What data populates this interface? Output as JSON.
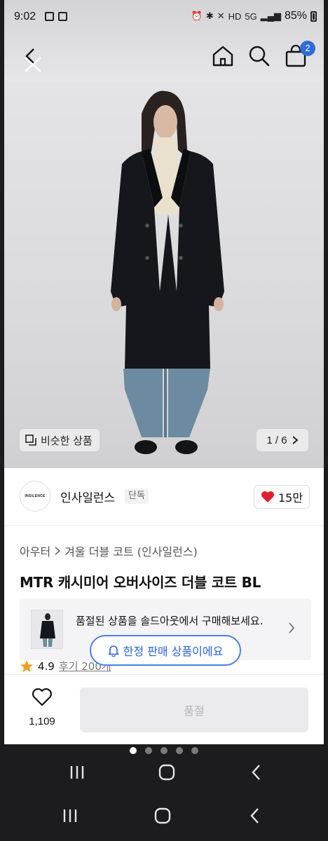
{
  "status_bar": {
    "time": "9:02",
    "network": "5G",
    "hd": "HD",
    "battery": "85%"
  },
  "header": {
    "cart_count": "2",
    "icons": [
      "back-icon",
      "home-icon",
      "search-icon",
      "shopping-bag-icon"
    ]
  },
  "hero": {
    "similar_label": "비슷한 상품",
    "page_indicator": "1 / 6"
  },
  "brand": {
    "logo_text": "INSILENCE",
    "name": "인사일런스",
    "tag": "단독",
    "likes": "15만"
  },
  "product": {
    "breadcrumb": [
      "아우터",
      "겨울 더블 코트 (인사일런스)"
    ],
    "title": "MTR 캐시미어 오버사이즈 더블 코트 BL",
    "rating": "4.9",
    "reviews": "후기 200개"
  },
  "soldout_card": {
    "text": "품절된 상품을 솔드아웃에서 구매해보세요."
  },
  "limited_pill": {
    "label": "한정 판매 상품이에요"
  },
  "bottom_bar": {
    "wish_count": "1,109",
    "buy_label": "품절"
  },
  "colors": {
    "accent_blue": "#2f6bd8",
    "heart_red": "#e0202e",
    "star_orange": "#f0a020"
  }
}
